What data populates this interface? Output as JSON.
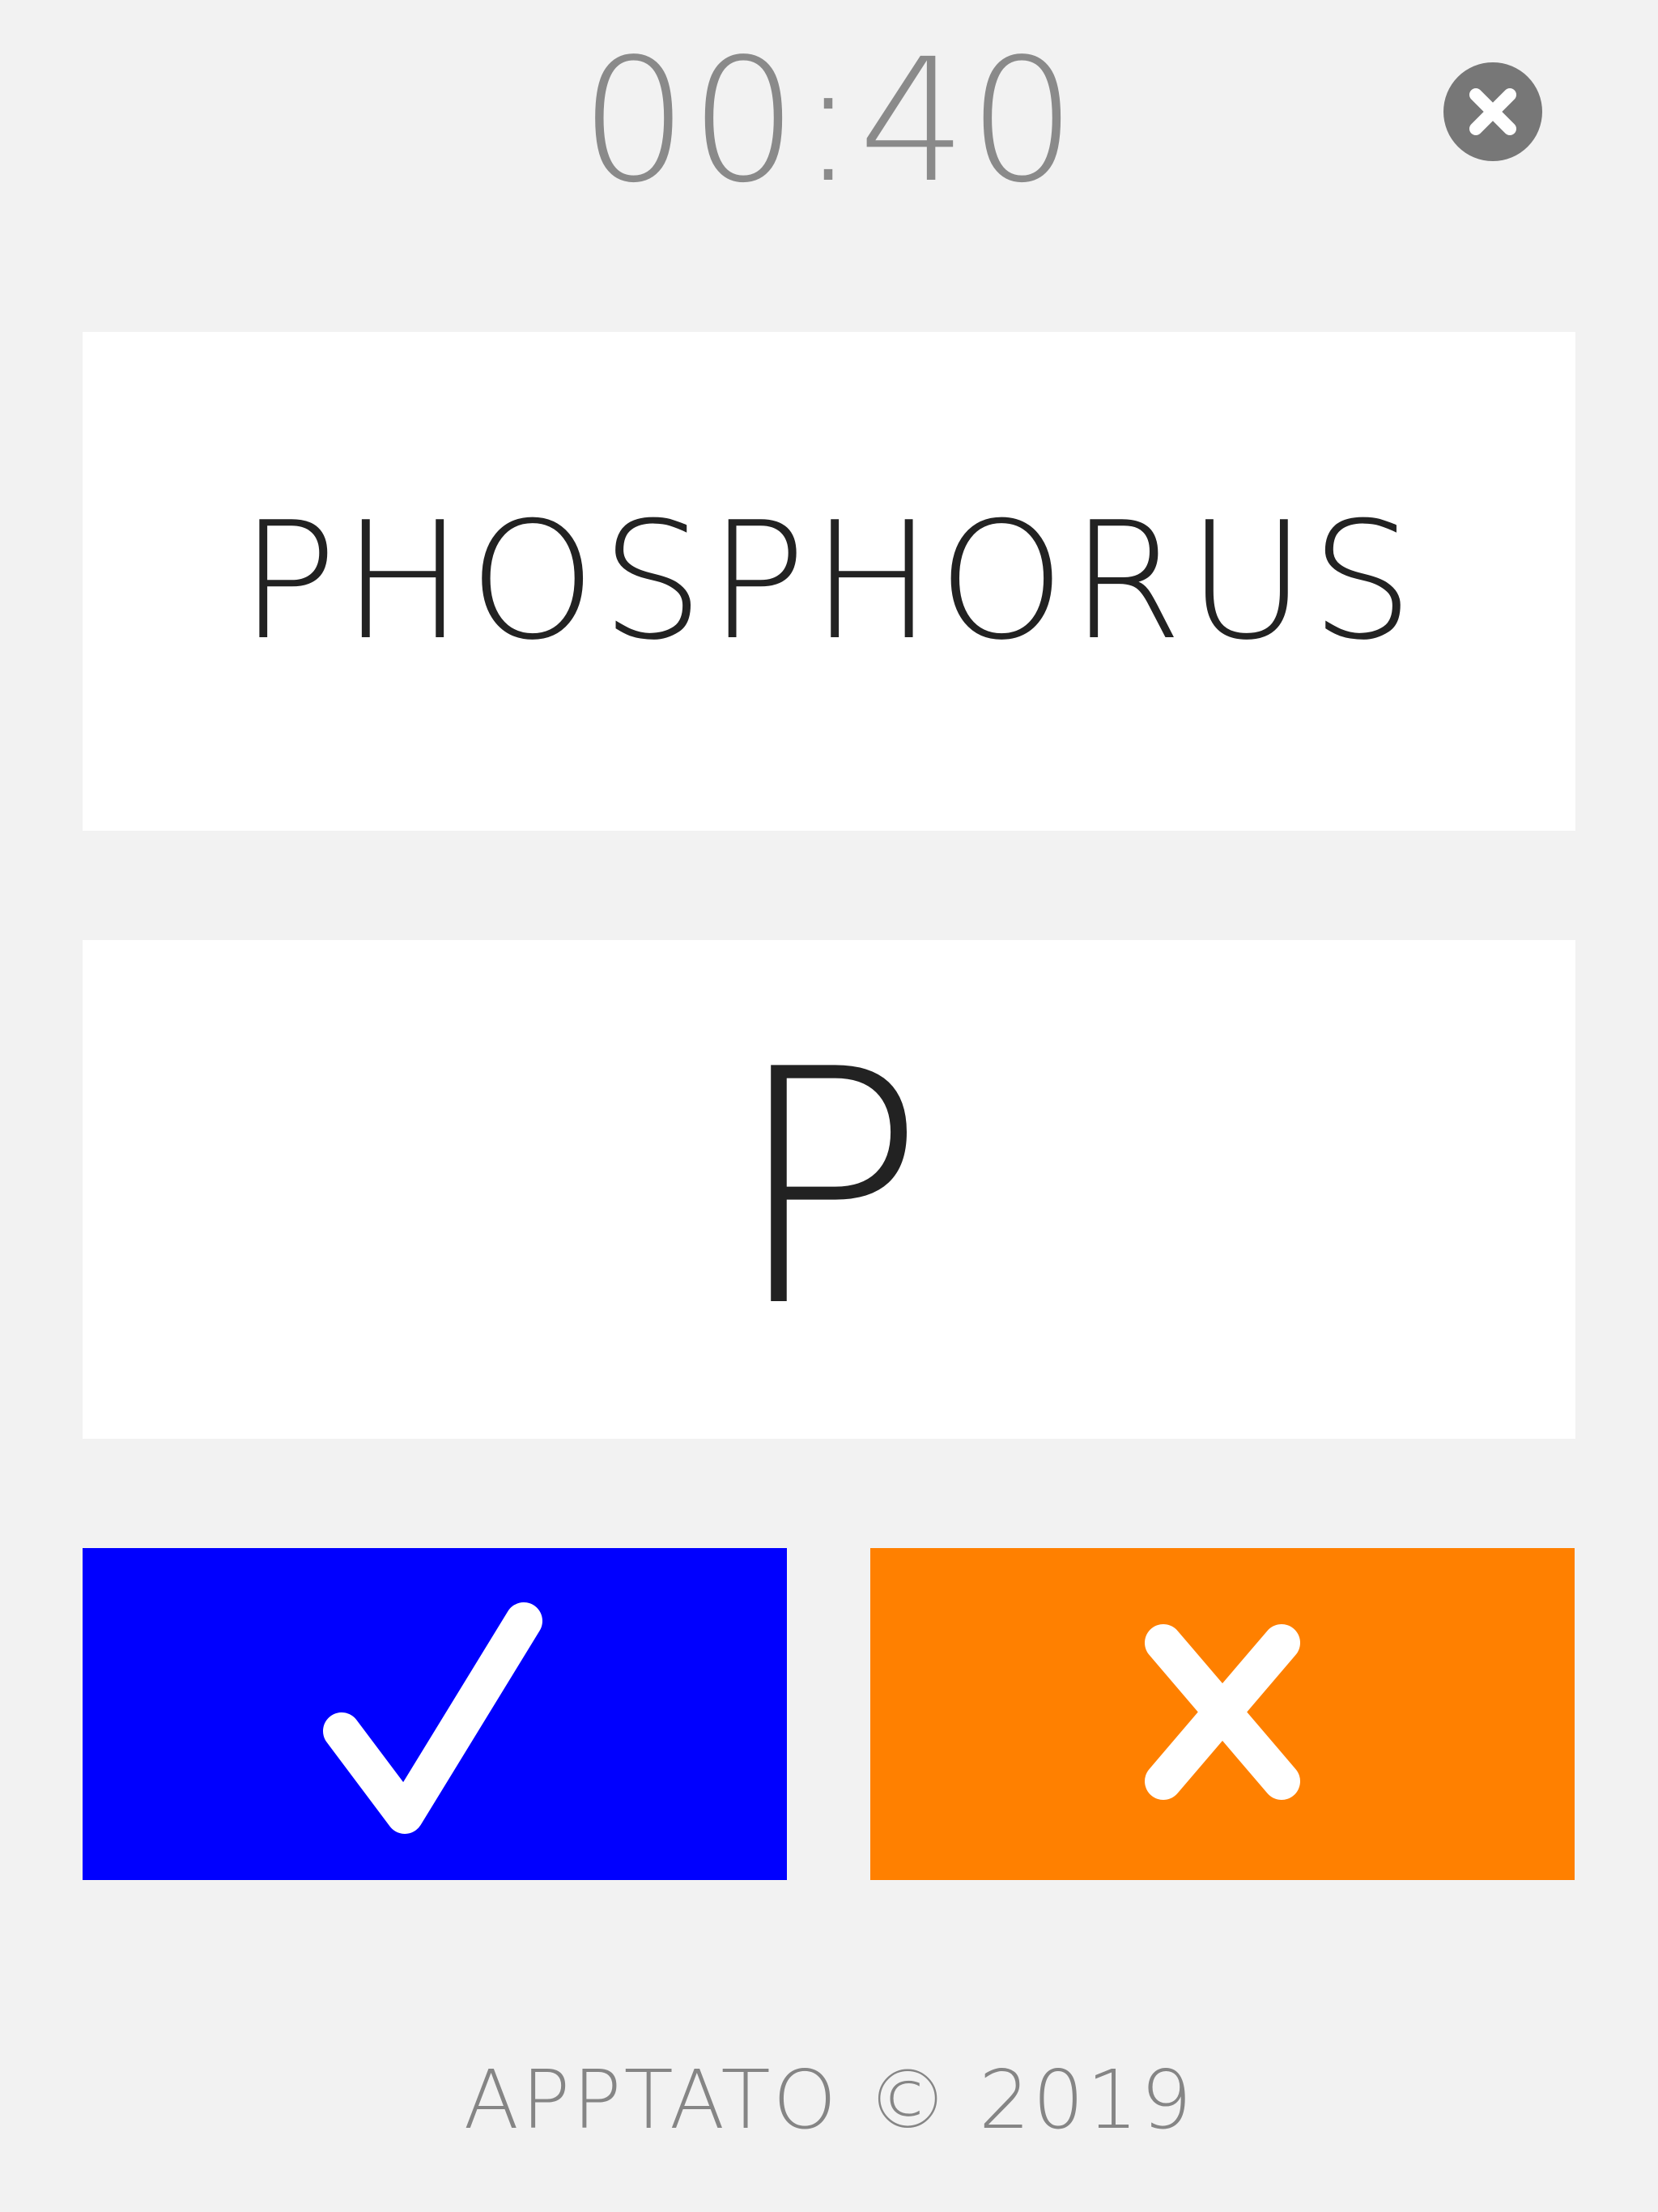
{
  "timer": {
    "value": "00:40"
  },
  "close_button": {
    "icon": "close-circle-icon",
    "color": "#777777"
  },
  "card_term": {
    "text": "PHOSPHORUS"
  },
  "card_answer": {
    "text": "P"
  },
  "actions": {
    "correct": {
      "icon": "checkmark-icon",
      "color": "#0000ff"
    },
    "wrong": {
      "icon": "x-mark-icon",
      "color": "#ff8000"
    }
  },
  "footer": {
    "text": "APPTATO © 2019"
  }
}
